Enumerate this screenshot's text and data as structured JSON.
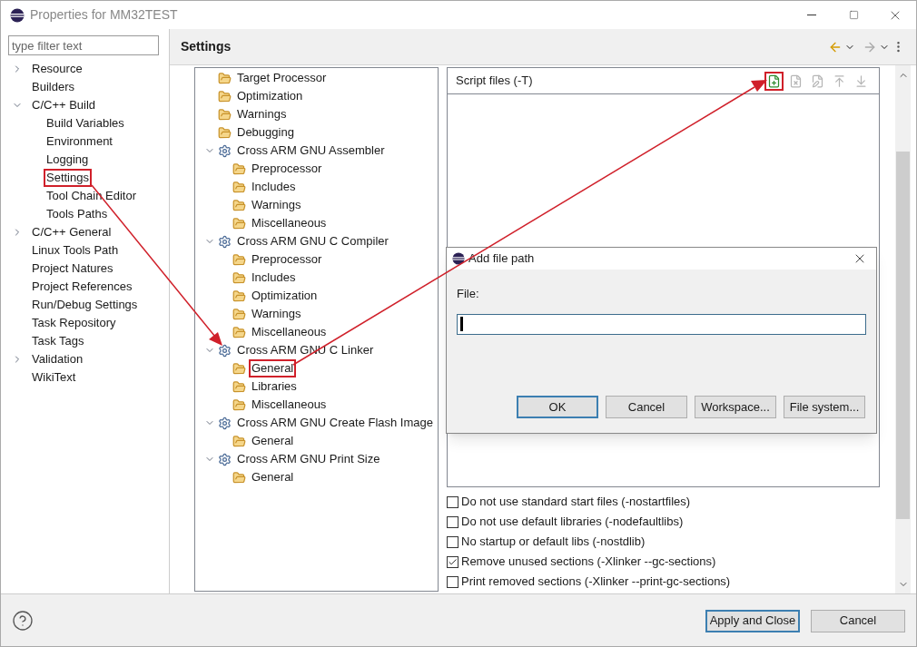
{
  "window": {
    "title": "Properties for MM32TEST"
  },
  "filter": {
    "placeholder": "type filter text"
  },
  "sidebar": {
    "items": [
      {
        "label": "Resource",
        "expanded": false,
        "highlighted": false
      },
      {
        "label": "Builders",
        "highlighted": false
      },
      {
        "label": "C/C++ Build",
        "expanded": true,
        "highlighted": false,
        "children": [
          {
            "label": "Build Variables",
            "highlighted": false
          },
          {
            "label": "Environment",
            "highlighted": false
          },
          {
            "label": "Logging",
            "highlighted": false
          },
          {
            "label": "Settings",
            "highlighted": true
          },
          {
            "label": "Tool Chain Editor",
            "highlighted": false
          },
          {
            "label": "Tools Paths",
            "highlighted": false
          }
        ]
      },
      {
        "label": "C/C++ General",
        "expanded": false,
        "highlighted": false
      },
      {
        "label": "Linux Tools Path",
        "highlighted": false
      },
      {
        "label": "Project Natures",
        "highlighted": false
      },
      {
        "label": "Project References",
        "highlighted": false
      },
      {
        "label": "Run/Debug Settings",
        "highlighted": false
      },
      {
        "label": "Task Repository",
        "highlighted": false
      },
      {
        "label": "Task Tags",
        "highlighted": false
      },
      {
        "label": "Validation",
        "expanded": false,
        "highlighted": false
      },
      {
        "label": "WikiText",
        "highlighted": false
      }
    ]
  },
  "page": {
    "title": "Settings"
  },
  "tool_tree": [
    {
      "label": "Target Processor",
      "kind": "category",
      "highlighted": false
    },
    {
      "label": "Optimization",
      "kind": "category",
      "highlighted": false
    },
    {
      "label": "Warnings",
      "kind": "category",
      "highlighted": false
    },
    {
      "label": "Debugging",
      "kind": "category",
      "highlighted": false
    },
    {
      "label": "Cross ARM GNU Assembler",
      "kind": "tool",
      "expanded": true,
      "highlighted": false,
      "children": [
        {
          "label": "Preprocessor",
          "kind": "category",
          "highlighted": false
        },
        {
          "label": "Includes",
          "kind": "category",
          "highlighted": false
        },
        {
          "label": "Warnings",
          "kind": "category",
          "highlighted": false
        },
        {
          "label": "Miscellaneous",
          "kind": "category",
          "highlighted": false
        }
      ]
    },
    {
      "label": "Cross ARM GNU C Compiler",
      "kind": "tool",
      "expanded": true,
      "highlighted": false,
      "children": [
        {
          "label": "Preprocessor",
          "kind": "category",
          "highlighted": false
        },
        {
          "label": "Includes",
          "kind": "category",
          "highlighted": false
        },
        {
          "label": "Optimization",
          "kind": "category",
          "highlighted": false
        },
        {
          "label": "Warnings",
          "kind": "category",
          "highlighted": false
        },
        {
          "label": "Miscellaneous",
          "kind": "category",
          "highlighted": false
        }
      ]
    },
    {
      "label": "Cross ARM GNU C Linker",
      "kind": "tool",
      "expanded": true,
      "highlighted": false,
      "children": [
        {
          "label": "General",
          "kind": "category",
          "highlighted": true
        },
        {
          "label": "Libraries",
          "kind": "category",
          "highlighted": false
        },
        {
          "label": "Miscellaneous",
          "kind": "category",
          "highlighted": false
        }
      ]
    },
    {
      "label": "Cross ARM GNU Create Flash Image",
      "kind": "tool",
      "expanded": true,
      "highlighted": false,
      "children": [
        {
          "label": "General",
          "kind": "category",
          "highlighted": false
        }
      ]
    },
    {
      "label": "Cross ARM GNU Print Size",
      "kind": "tool",
      "expanded": true,
      "highlighted": false,
      "children": [
        {
          "label": "General",
          "kind": "category",
          "highlighted": false
        }
      ]
    }
  ],
  "script_files": {
    "label": "Script files (-T)",
    "toolbar": [
      {
        "kind": "add",
        "disabled": false,
        "highlighted": true
      },
      {
        "kind": "delete",
        "disabled": true,
        "highlighted": false
      },
      {
        "kind": "edit",
        "disabled": true,
        "highlighted": false
      },
      {
        "kind": "up",
        "disabled": true,
        "highlighted": false
      },
      {
        "kind": "down",
        "disabled": true,
        "highlighted": false
      }
    ]
  },
  "options": [
    {
      "label": "Do not use standard start files (-nostartfiles)",
      "checked": false
    },
    {
      "label": "Do not use default libraries (-nodefaultlibs)",
      "checked": false
    },
    {
      "label": "No startup or default libs (-nostdlib)",
      "checked": false
    },
    {
      "label": "Remove unused sections (-Xlinker --gc-sections)",
      "checked": true
    },
    {
      "label": "Print removed sections (-Xlinker --print-gc-sections)",
      "checked": false
    }
  ],
  "buttons": [
    {
      "label": "Apply and Close",
      "selected": true
    },
    {
      "label": "Cancel",
      "selected": false
    }
  ],
  "dialog": {
    "title": "Add file path",
    "field_label": "File:",
    "buttons": [
      {
        "label": "OK",
        "selected": true
      },
      {
        "label": "Cancel",
        "selected": false
      },
      {
        "label": "Workspace...",
        "selected": false
      },
      {
        "label": "File system...",
        "selected": false
      }
    ]
  }
}
